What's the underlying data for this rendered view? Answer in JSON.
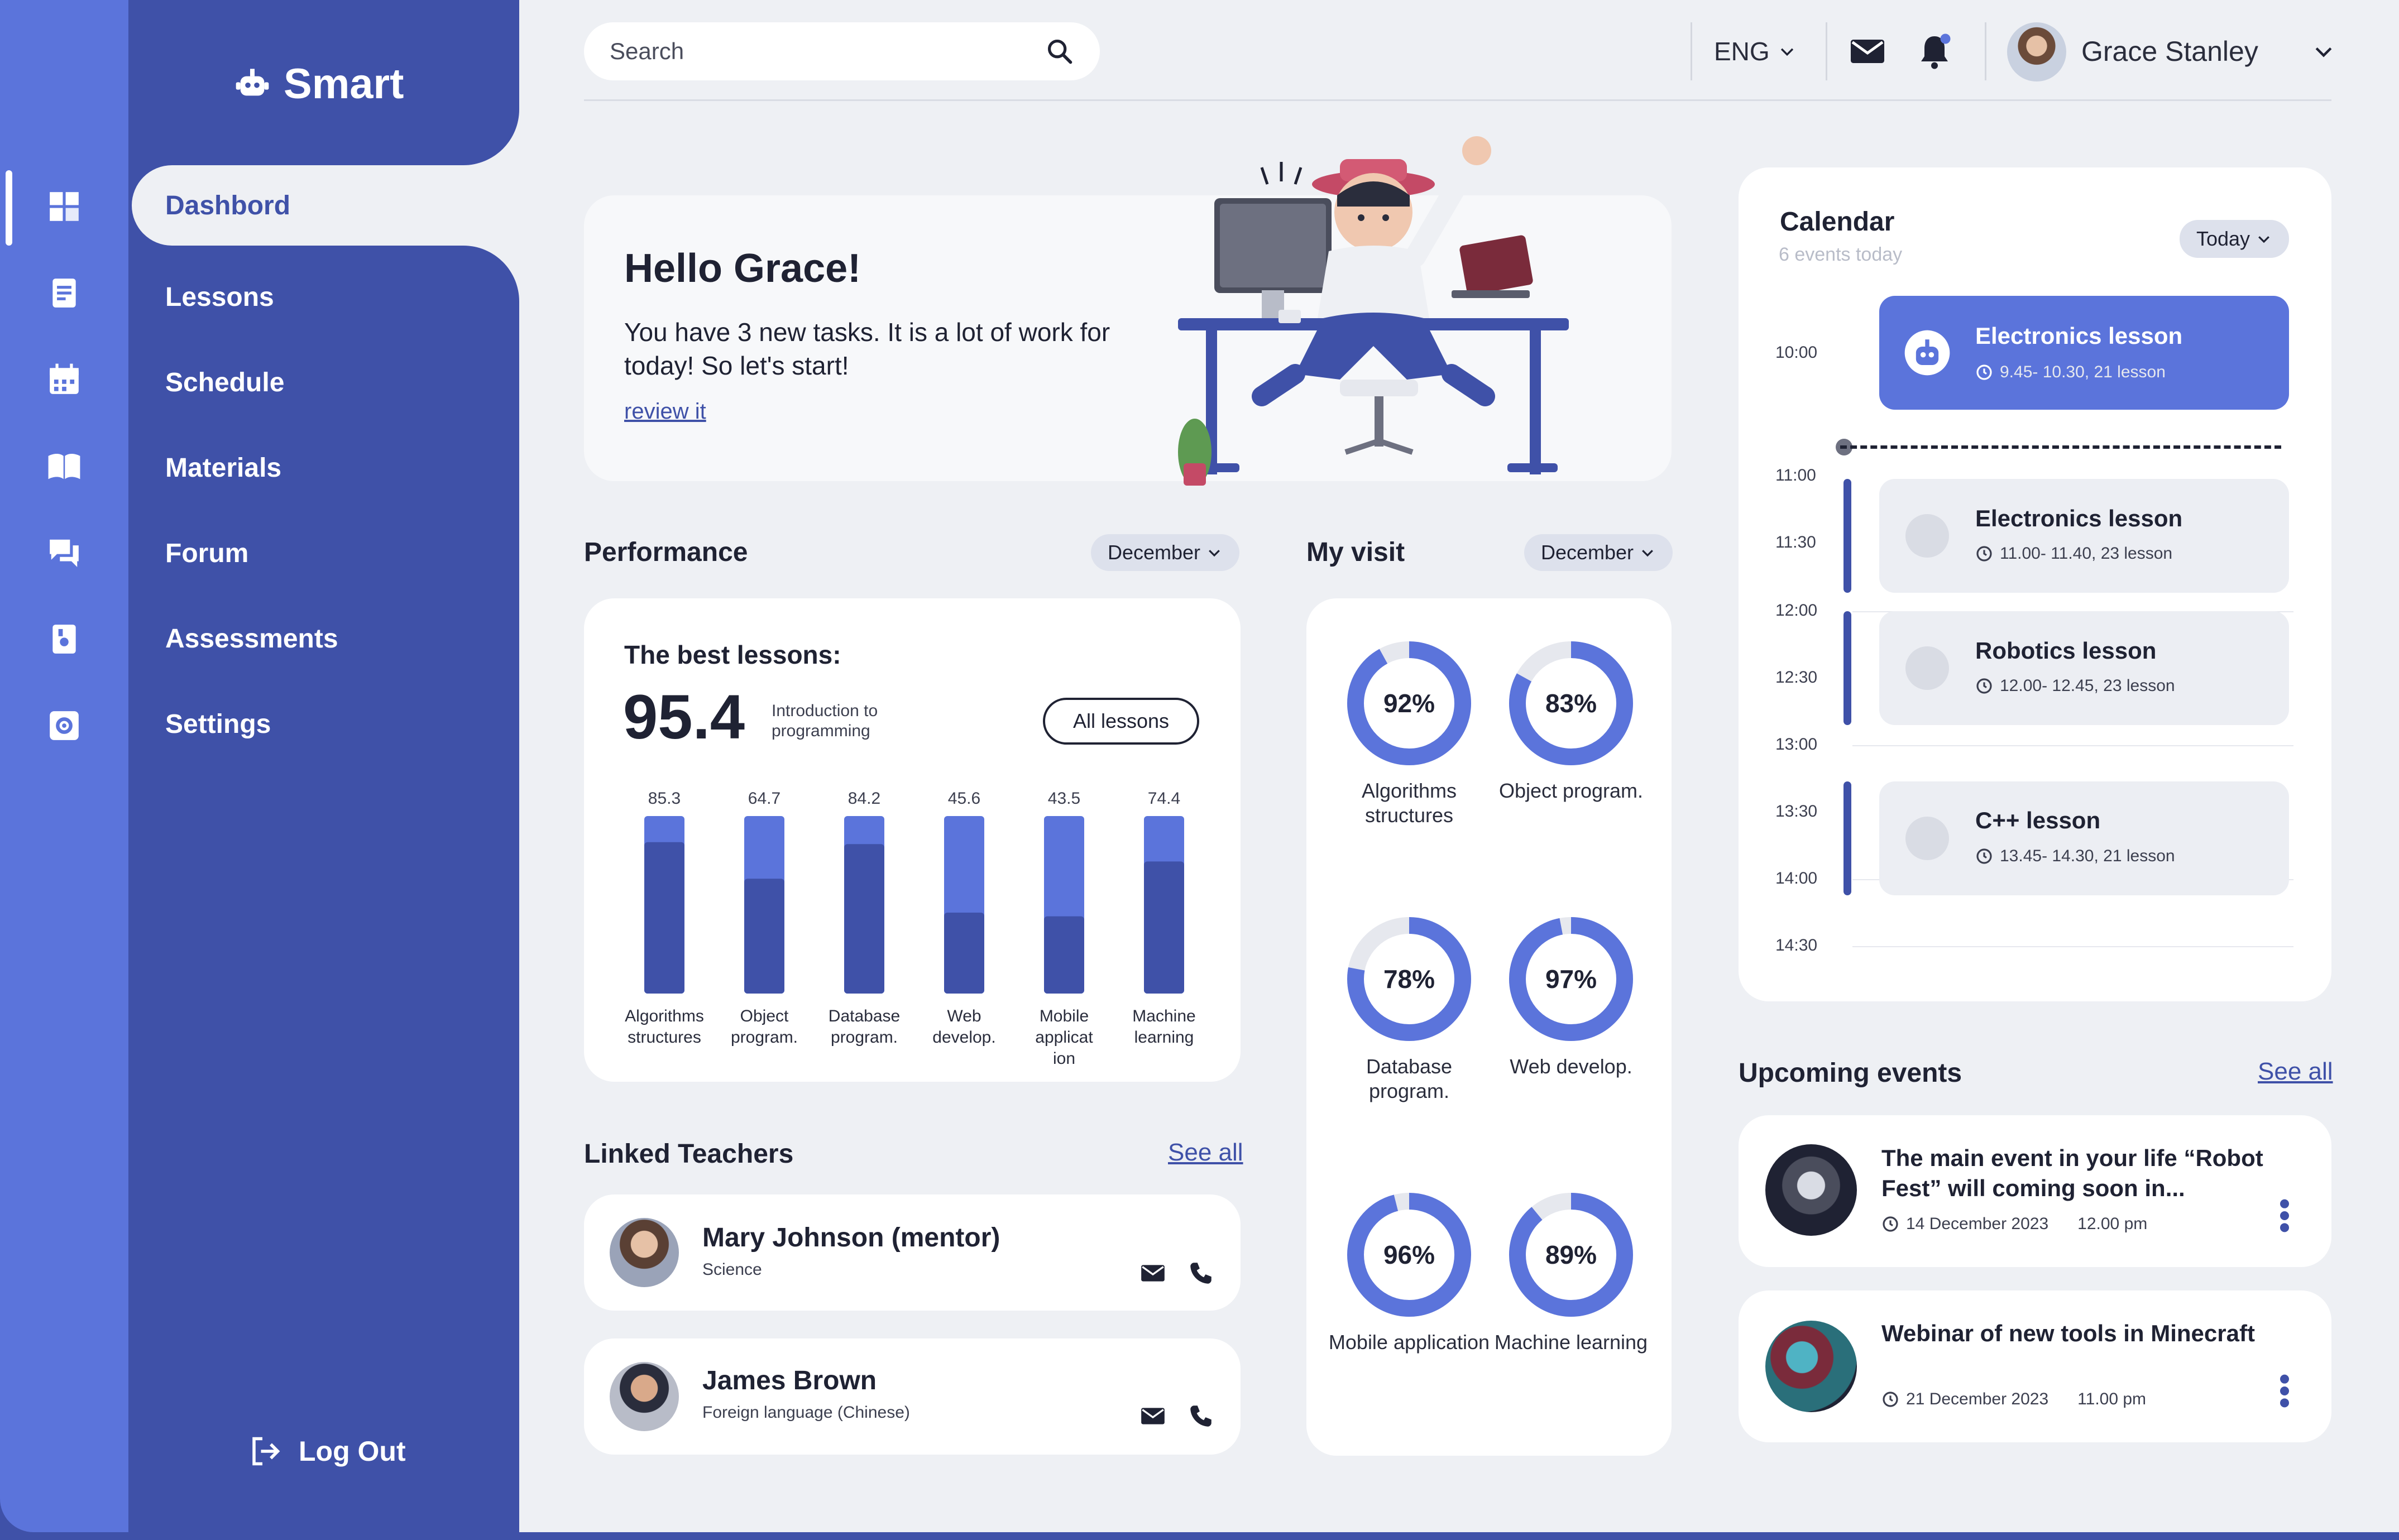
{
  "app": {
    "name": "Smart"
  },
  "colors": {
    "primary": "#3f51a8",
    "accent": "#5b74db",
    "background": "#eef0f4",
    "card": "#ffffff"
  },
  "nav": {
    "items": [
      {
        "label": "Dashbord",
        "icon": "dashboard-icon",
        "active": true
      },
      {
        "label": "Lessons",
        "icon": "lessons-icon"
      },
      {
        "label": "Schedule",
        "icon": "calendar-icon"
      },
      {
        "label": "Materials",
        "icon": "book-icon"
      },
      {
        "label": "Forum",
        "icon": "forum-icon"
      },
      {
        "label": "Assessments",
        "icon": "assessments-icon"
      },
      {
        "label": "Settings",
        "icon": "settings-icon"
      }
    ],
    "logout_label": "Log Out"
  },
  "topbar": {
    "search_placeholder": "Search",
    "language": "ENG",
    "user_name": "Grace Stanley"
  },
  "hero": {
    "title": "Hello Grace!",
    "text": "You have 3 new tasks. It is a lot of work for today! So let's start!",
    "link": "review it"
  },
  "performance": {
    "title": "Performance",
    "month": "December",
    "best_title": "The best lessons:",
    "best_score": "95.4",
    "best_subject": "Introduction to programming",
    "all_lessons_label": "All lessons"
  },
  "chart_data": {
    "type": "bar",
    "categories": [
      "Algorithms structures",
      "Object program.",
      "Database program.",
      "Web develop.",
      "Mobile applicat ion",
      "Machine learning"
    ],
    "values": [
      85.3,
      64.7,
      84.2,
      45.6,
      43.5,
      74.4
    ],
    "ylim": [
      0,
      100
    ],
    "grid": false
  },
  "visit": {
    "title": "My visit",
    "month": "December",
    "items": [
      {
        "label": "Algorithms structures",
        "value": 92
      },
      {
        "label": "Object program.",
        "value": 83
      },
      {
        "label": "Database program.",
        "value": 78
      },
      {
        "label": "Web develop.",
        "value": 97
      },
      {
        "label": "Mobile application",
        "value": 96
      },
      {
        "label": "Machine learning",
        "value": 89
      }
    ]
  },
  "teachers": {
    "title": "Linked Teachers",
    "see_all": "See all",
    "items": [
      {
        "name": "Mary Johnson (mentor)",
        "subject": "Science"
      },
      {
        "name": "James Brown",
        "subject": "Foreign language (Chinese)"
      }
    ]
  },
  "calendar": {
    "title": "Calendar",
    "subtitle": "6 events today",
    "filter": "Today",
    "times": [
      "10:00",
      "11:00",
      "11:30",
      "12:00",
      "12:30",
      "13:00",
      "13:30",
      "14:00",
      "14:30"
    ],
    "events": [
      {
        "title": "Electronics lesson",
        "meta": "9.45- 10.30, 21 lesson"
      },
      {
        "title": "Electronics lesson",
        "meta": "11.00- 11.40, 23 lesson"
      },
      {
        "title": "Robotics lesson",
        "meta": "12.00- 12.45, 23 lesson"
      },
      {
        "title": "C++ lesson",
        "meta": "13.45- 14.30, 21 lesson"
      }
    ]
  },
  "upcoming": {
    "title": "Upcoming events",
    "see_all": "See all",
    "items": [
      {
        "title": "The main event in your life “Robot Fest” will coming soon in...",
        "date": "14 December 2023",
        "time": "12.00 pm"
      },
      {
        "title": "Webinar of new tools in Minecraft",
        "date": "21 December 2023",
        "time": "11.00 pm"
      }
    ]
  }
}
